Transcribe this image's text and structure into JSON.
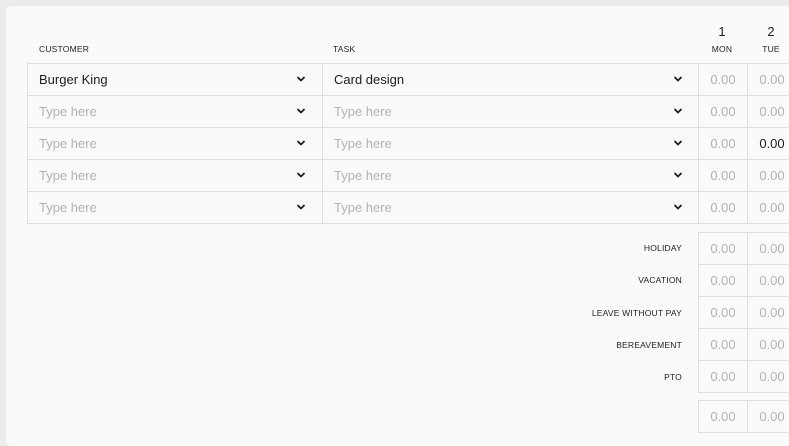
{
  "headers": {
    "customer": "CUSTOMER",
    "task": "TASK"
  },
  "days": [
    {
      "num": "1",
      "name": "MON"
    },
    {
      "num": "2",
      "name": "TUE"
    }
  ],
  "rows": [
    {
      "customer": "Burger King",
      "customer_placeholder": false,
      "task": "Card design",
      "task_placeholder": false,
      "mon": "0.00",
      "tue": "0.00",
      "tue_filled": false
    },
    {
      "customer": "Type here",
      "customer_placeholder": true,
      "task": "Type here",
      "task_placeholder": true,
      "mon": "0.00",
      "tue": "0.00",
      "tue_filled": false
    },
    {
      "customer": "Type here",
      "customer_placeholder": true,
      "task": "Type here",
      "task_placeholder": true,
      "mon": "0.00",
      "tue": "0.00",
      "tue_filled": true
    },
    {
      "customer": "Type here",
      "customer_placeholder": true,
      "task": "Type here",
      "task_placeholder": true,
      "mon": "0.00",
      "tue": "0.00",
      "tue_filled": false
    },
    {
      "customer": "Type here",
      "customer_placeholder": true,
      "task": "Type here",
      "task_placeholder": true,
      "mon": "0.00",
      "tue": "0.00",
      "tue_filled": false
    }
  ],
  "leave": [
    {
      "label": "HOLIDAY",
      "mon": "0.00",
      "tue": "0.00"
    },
    {
      "label": "VACATION",
      "mon": "0.00",
      "tue": "0.00"
    },
    {
      "label": "LEAVE WITHOUT PAY",
      "mon": "0.00",
      "tue": "0.00"
    },
    {
      "label": "BEREAVEMENT",
      "mon": "0.00",
      "tue": "0.00"
    },
    {
      "label": "PTO",
      "mon": "0.00",
      "tue": "0.00"
    }
  ],
  "totals": {
    "mon": "0.00",
    "tue": "0.00"
  },
  "icons": {
    "dropdown": "chevron-down-icon"
  },
  "colors": {
    "text": "#1c1c1c",
    "placeholder": "#b2b2b2",
    "border": "#dedede",
    "background": "#fafafa"
  }
}
